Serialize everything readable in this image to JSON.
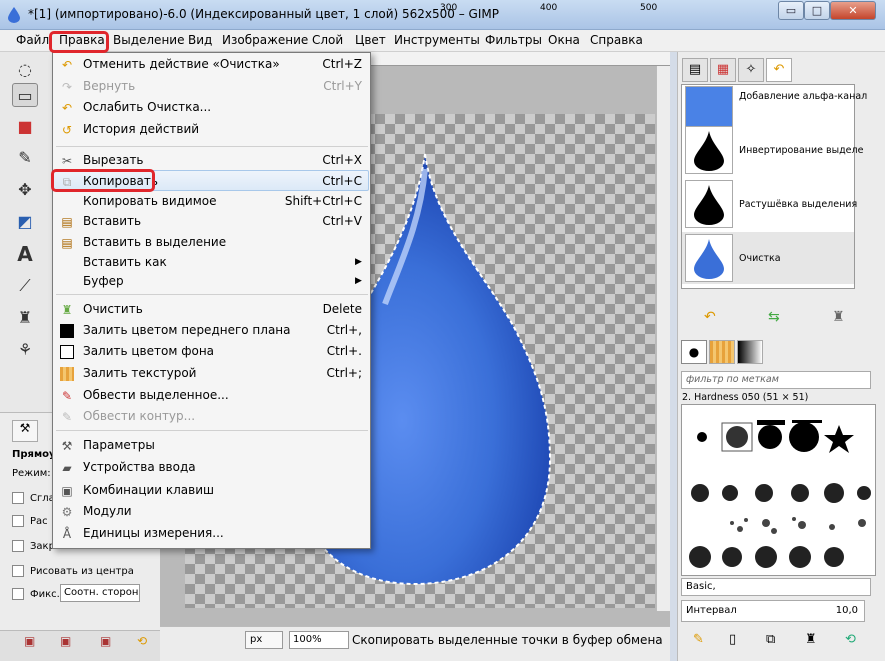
{
  "window": {
    "title": "*[1] (импортировано)-6.0 (Индексированный цвет, 1 слой) 562x500 – GIMP",
    "min_glyph": "▭",
    "max_glyph": "□",
    "close_glyph": "✕"
  },
  "menubar": {
    "items": [
      "Файл",
      "Правка",
      "Выделение",
      "Вид",
      "Изображение",
      "Слой",
      "Цвет",
      "Инструменты",
      "Фильтры",
      "Окна",
      "Справка"
    ]
  },
  "edit_menu": {
    "items": [
      {
        "label": "Отменить действие «Очистка»",
        "shortcut": "Ctrl+Z",
        "icon": "undo-icon",
        "enabled": true
      },
      {
        "label": "Вернуть",
        "shortcut": "Ctrl+Y",
        "icon": "redo-icon",
        "enabled": false
      },
      {
        "label": "Ослабить Очистка...",
        "shortcut": "",
        "icon": "fade-icon",
        "enabled": true
      },
      {
        "label": "История действий",
        "shortcut": "",
        "icon": "history-icon",
        "enabled": true
      },
      {
        "label": "Вырезать",
        "shortcut": "Ctrl+X",
        "icon": "cut-icon",
        "enabled": true
      },
      {
        "label": "Копировать",
        "shortcut": "Ctrl+C",
        "icon": "copy-icon",
        "enabled": true
      },
      {
        "label": "Копировать видимое",
        "shortcut": "Shift+Ctrl+C",
        "icon": "",
        "enabled": true
      },
      {
        "label": "Вставить",
        "shortcut": "Ctrl+V",
        "icon": "paste-icon",
        "enabled": true
      },
      {
        "label": "Вставить в выделение",
        "shortcut": "",
        "icon": "paste-into-icon",
        "enabled": true
      },
      {
        "label": "Вставить как",
        "shortcut": "",
        "icon": "",
        "enabled": true
      },
      {
        "label": "Буфер",
        "shortcut": "",
        "icon": "",
        "enabled": true
      },
      {
        "label": "Очистить",
        "shortcut": "Delete",
        "icon": "clear-icon",
        "enabled": true
      },
      {
        "label": "Залить цветом переднего плана",
        "shortcut": "Ctrl+,",
        "icon": "fill-fg-icon",
        "enabled": true
      },
      {
        "label": "Залить цветом фона",
        "shortcut": "Ctrl+.",
        "icon": "fill-bg-icon",
        "enabled": true
      },
      {
        "label": "Залить текстурой",
        "shortcut": "Ctrl+;",
        "icon": "fill-pattern-icon",
        "enabled": true
      },
      {
        "label": "Обвести выделенное...",
        "shortcut": "",
        "icon": "stroke-selection-icon",
        "enabled": true
      },
      {
        "label": "Обвести контур...",
        "shortcut": "",
        "icon": "stroke-path-icon",
        "enabled": false
      },
      {
        "label": "Параметры",
        "shortcut": "",
        "icon": "preferences-icon",
        "enabled": true
      },
      {
        "label": "Устройства ввода",
        "shortcut": "",
        "icon": "input-devices-icon",
        "enabled": true
      },
      {
        "label": "Комбинации клавиш",
        "shortcut": "",
        "icon": "keyboard-icon",
        "enabled": true
      },
      {
        "label": "Модули",
        "shortcut": "",
        "icon": "modules-icon",
        "enabled": true
      },
      {
        "label": "Единицы измерения...",
        "shortcut": "",
        "icon": "units-icon",
        "enabled": true
      }
    ]
  },
  "ruler": {
    "ticks": [
      "300",
      "400",
      "500"
    ]
  },
  "tool_options": {
    "title": "Прямоу",
    "mode_label": "Режим:",
    "rows": [
      "Сгла",
      "Рас",
      "Закр",
      "Рисовать из центра",
      "Фикс.:"
    ],
    "fixed_combo": "Соотн. сторон"
  },
  "history": {
    "items": [
      "Добавление альфа-канал",
      "Инвертирование выделе",
      "Растушёвка выделения",
      "Очистка"
    ]
  },
  "brushes": {
    "filter_placeholder": "фильтр по меткам",
    "selected": "2. Hardness 050 (51 × 51)",
    "preset": "Basic,",
    "interval_label": "Интервал",
    "interval_value": "10,0"
  },
  "statusbar": {
    "unit": "px",
    "zoom": "100%",
    "message": "Скопировать выделенные точки в буфер обмена"
  },
  "colors": {
    "highlight_red": "#e0262c",
    "drop_blue": "#3a6fd8"
  }
}
